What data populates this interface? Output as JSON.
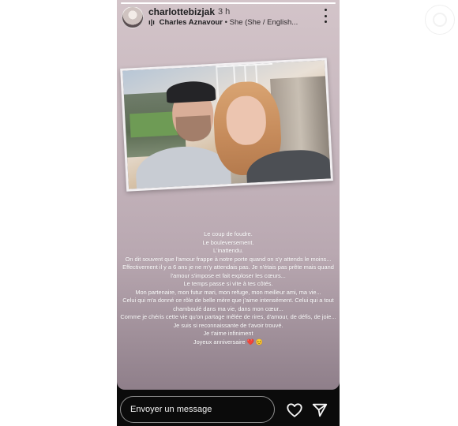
{
  "story": {
    "username": "charlottebizjak",
    "time": "3 h",
    "music": {
      "icon": "music-bars-icon",
      "icon_glyph": "ı|ı",
      "artist": "Charles Aznavour",
      "separator": "•",
      "title": "She (She / English..."
    },
    "progress": 1.0
  },
  "caption_lines": [
    "Le coup de foudre.",
    "Le bouleversement.",
    "L'inattendu.",
    "On dit souvent que l'amour frappe à notre porte quand on s'y attends le moins...",
    "Effectivement il y a 6 ans je ne m'y attendais pas. Je n'étais pas prête mais quand",
    "l'amour s'impose et fait exploser les cœurs...",
    "Le temps passe si vite à tes côtés.",
    "Mon partenaire, mon futur mari, mon refuge, mon meilleur ami, ma vie...",
    "Celui qui m'a donné ce rôle de belle mère que j'aime intensément. Celui qui a tout",
    "chamboulé dans ma vie, dans mon cœur...",
    "Comme je chéris cette vie qu'on partage mêlée de rires, d'amour, de défis, de joie...",
    "Je suis si reconnaissante de t'avoir trouvé.",
    "Je t'aime infiniment",
    "Joyeux anniversaire ❤️ 😊"
  ],
  "reply": {
    "placeholder": "Envoyer un message"
  },
  "colors": {
    "story_top": "#d3c4c9",
    "story_bottom": "#8f7f8a",
    "frame": "#0b0b0b"
  }
}
